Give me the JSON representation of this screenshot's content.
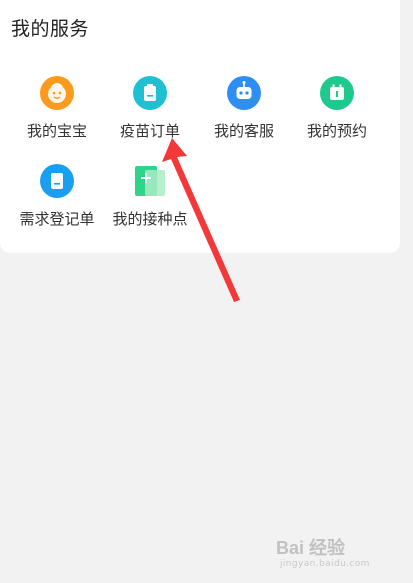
{
  "section": {
    "title": "我的服务"
  },
  "services": [
    {
      "label": "我的宝宝",
      "icon": "baby-face-icon",
      "color": "#fb9a1c"
    },
    {
      "label": "疫苗订单",
      "icon": "vaccine-order-icon",
      "color": "#1ec1d2"
    },
    {
      "label": "我的客服",
      "icon": "robot-service-icon",
      "color": "#2f8ef3"
    },
    {
      "label": "我的预约",
      "icon": "calendar-icon",
      "color": "#1fc98e"
    },
    {
      "label": "需求登记单",
      "icon": "registration-form-icon",
      "color": "#1a9ef0"
    },
    {
      "label": "我的接种点",
      "icon": "vaccination-site-icon",
      "color": "#2ed48a"
    }
  ],
  "watermark": {
    "text": "Bai 经验",
    "sub": "jingyan.baidu.com"
  },
  "annotation": {
    "color": "#f23838",
    "target": "疫苗订单"
  }
}
